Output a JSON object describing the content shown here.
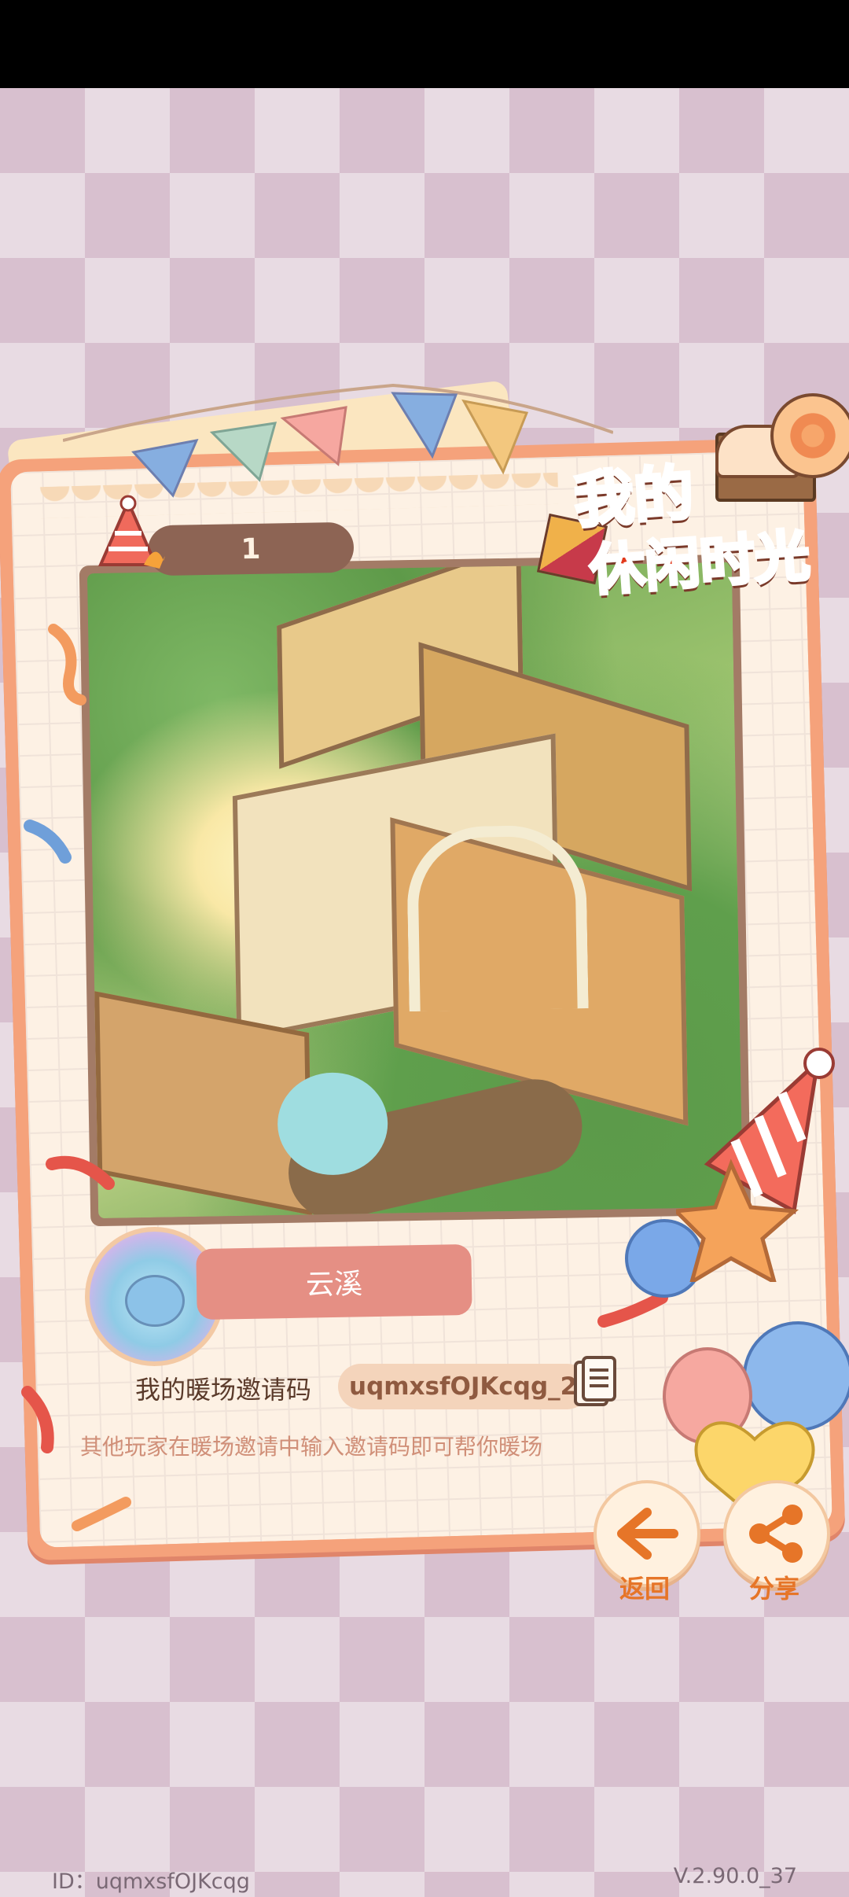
{
  "card": {
    "page_number": "1",
    "player_name": "云溪"
  },
  "logo": {
    "line1": "我的",
    "line2": "休闲时光"
  },
  "invite": {
    "label": "我的暖场邀请码",
    "code": "uqmxsfOJKcqg_21",
    "hint": "其他玩家在暖场邀请中输入邀请码即可帮你暖场"
  },
  "buttons": {
    "back": "返回",
    "share": "分享"
  },
  "footer": {
    "id": "ID：uqmxsfOJKcqg",
    "version": "V.2.90.0_37"
  },
  "colors": {
    "accent": "#e67528",
    "name_pill": "#e58f84",
    "frame": "#f5a27b"
  },
  "icons": {
    "back": "arrow-left-icon",
    "share": "share-icon",
    "copy": "copy-document-icon"
  }
}
